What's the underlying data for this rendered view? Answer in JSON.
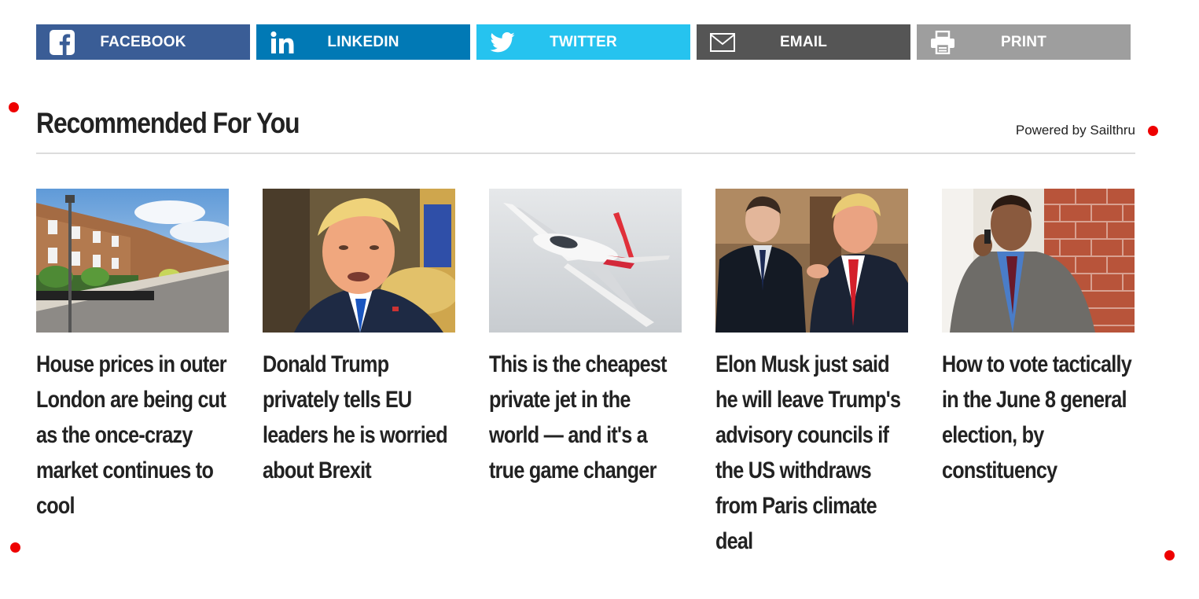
{
  "share": {
    "facebook": {
      "label": "FACEBOOK",
      "icon": "facebook-icon",
      "color": "#3a5d96"
    },
    "linkedin": {
      "label": "LINKEDIN",
      "icon": "linkedin-icon",
      "color": "#0179b5"
    },
    "twitter": {
      "label": "TWITTER",
      "icon": "twitter-icon",
      "color": "#26c3ef"
    },
    "email": {
      "label": "EMAIL",
      "icon": "envelope-icon",
      "color": "#555555"
    },
    "print": {
      "label": "PRINT",
      "icon": "printer-icon",
      "color": "#9e9e9e"
    }
  },
  "recommended": {
    "title": "Recommended For You",
    "powered_by": "Powered by Sailthru",
    "articles": [
      {
        "headline": "House prices in outer London are being cut as the once-crazy market continues to cool"
      },
      {
        "headline": "Donald Trump privately tells EU leaders he is worried about Brexit"
      },
      {
        "headline": "This is the cheapest private jet in the world — and it's a true game changer"
      },
      {
        "headline": "Elon Musk just said he will leave Trump's advisory councils if the US withdraws from Paris climate deal"
      },
      {
        "headline": "How to vote tactically in the June 8 general election, by constituency"
      }
    ]
  }
}
